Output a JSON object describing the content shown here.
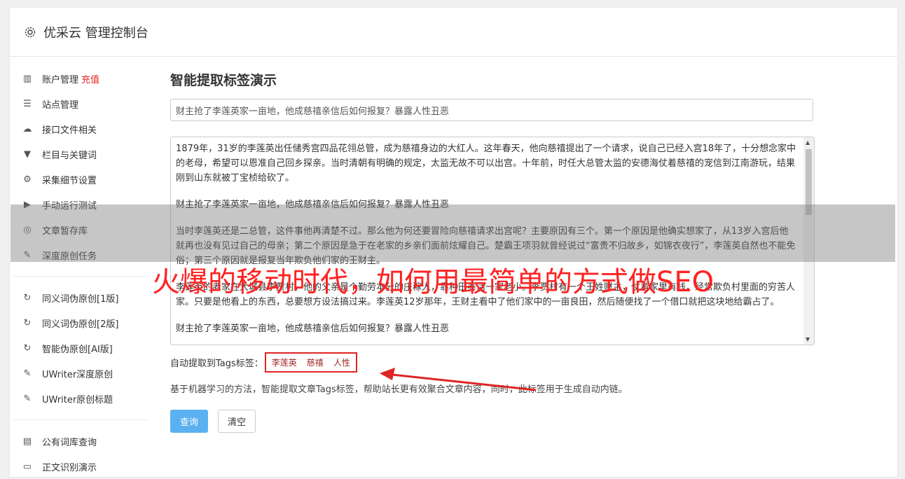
{
  "header": {
    "icon": "gear-icon",
    "title": "优采云 管理控制台"
  },
  "sidebar": {
    "group1": [
      {
        "icon": "bar-chart-icon",
        "label": "账户管理",
        "highlight": "充值"
      },
      {
        "icon": "server-icon",
        "label": "站点管理"
      },
      {
        "icon": "cloud-upload-icon",
        "label": "接口文件相关"
      },
      {
        "icon": "filter-icon",
        "label": "栏目与关键词"
      },
      {
        "icon": "gears-icon",
        "label": "采集细节设置"
      },
      {
        "icon": "play-circle-icon",
        "label": "手动运行测试"
      },
      {
        "icon": "database-icon",
        "label": "文章暂存库"
      },
      {
        "icon": "edit-icon",
        "label": "深度原创任务"
      }
    ],
    "group2": [
      {
        "icon": "refresh-icon",
        "label": "同义词伪原创[1版]"
      },
      {
        "icon": "refresh-icon",
        "label": "同义词伪原创[2版]"
      },
      {
        "icon": "refresh-icon",
        "label": "智能伪原创[AI版]"
      },
      {
        "icon": "edit-icon",
        "label": "UWriter深度原创"
      },
      {
        "icon": "edit-icon",
        "label": "UWriter原创标题"
      }
    ],
    "group3": [
      {
        "icon": "book-icon",
        "label": "公有词库查询"
      },
      {
        "icon": "square-icon",
        "label": "正文识别演示"
      }
    ]
  },
  "main": {
    "title": "智能提取标签演示",
    "title_input": "财主抢了李莲英家一亩地，他成慈禧亲信后如何报复？暴露人性丑恶",
    "article": [
      "1879年，31岁的李莲英出任储秀宫四品花翎总管，成为慈禧身边的大红人。这年春天，他向慈禧提出了一个请求，说自己已经入宫18年了，十分想念家中的老母，希望可以恩准自己回乡探亲。当时清朝有明确的规定，太监无故不可以出宫。十年前，时任大总管太监的安德海仗着慈禧的宠信到江南游玩，结果刚到山东就被丁宝桢给砍了。",
      "财主抢了李莲英家一亩地，他成慈禧亲信后如何报复？暴露人性丑恶",
      "当时李莲英还是二总管，这件事他再清楚不过。那么他为何还要冒险向慈禧请求出宫呢？主要原因有三个。第一个原因是他确实想家了，从13岁入宫后他就再也没有见过自己的母亲；第二个原因是急于在老家的乡亲们面前炫耀自己。楚霸王项羽就曾经说过“富贵不归故乡，如锦衣夜行”，李莲英自然也不能免俗；第三个原因就是报复当年欺负他们家的王财主。",
      "李莲英的老家在大城县李贾村，他的父亲是个勤劳本分的庄稼人，靠种田养活一家老小。李贾村有一个王姓财主，仗着家里有钱，经常欺负村里面的穷苦人家。只要是他看上的东西，总要想方设法搞过来。李莲英12岁那年，王财主看中了他们家中的一亩良田，然后随便找了一个借口就把这块地给霸占了。",
      "财主抢了李莲英家一亩地，他成慈禧亲信后如何报复？暴露人性丑恶"
    ],
    "tags_label": "自动提取到Tags标签：",
    "tags": [
      "李莲英",
      "慈禧",
      "人性"
    ],
    "description": "基于机器学习的方法，智能提取文章Tags标签，帮助站长更有效聚合文章内容，同时，此标签用于生成自动内链。",
    "query_button": "查询",
    "clear_button": "清空"
  },
  "banner": "火爆的移动时代，如何用最简单的方式做SEO",
  "colors": {
    "accent": "#5bb1f0",
    "highlight": "#e02424",
    "tag": "#9e1d1d"
  }
}
